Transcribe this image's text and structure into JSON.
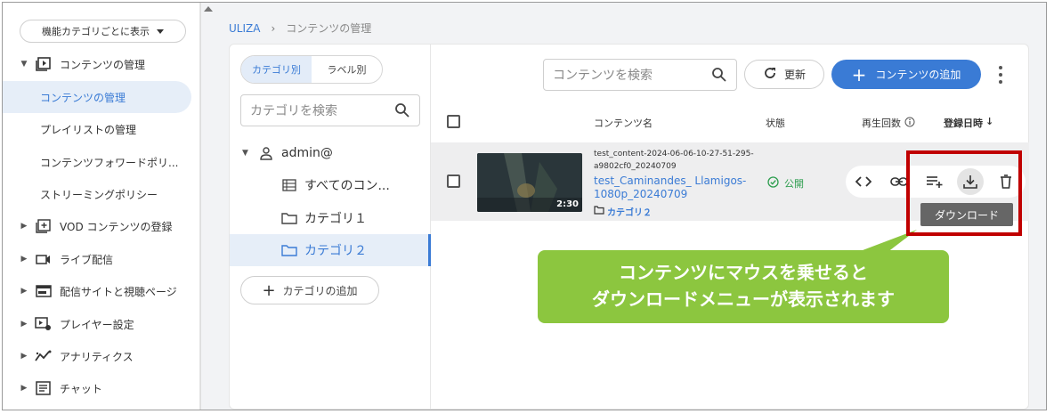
{
  "sidebar": {
    "view_select": "機能カテゴリごとに表示",
    "section_contents": "コンテンツの管理",
    "sub_items": [
      "コンテンツの管理",
      "プレイリストの管理",
      "コンテンツフォワードポリ...",
      "ストリーミングポリシー"
    ],
    "groups": [
      "VOD コンテンツの登録",
      "ライブ配信",
      "配信サイトと視聴ページ",
      "プレイヤー設定",
      "アナリティクス",
      "チャット"
    ]
  },
  "breadcrumb": {
    "root": "ULIZA",
    "sep": "›",
    "current": "コンテンツの管理"
  },
  "category_panel": {
    "toggle_category": "カテゴリ別",
    "toggle_label": "ラベル別",
    "search_placeholder": "カテゴリを検索",
    "tree": {
      "root": "admin@",
      "all": "すべてのコン...",
      "cat1": "カテゴリ１",
      "cat2": "カテゴリ２"
    },
    "add_button": "カテゴリの追加"
  },
  "toolbar": {
    "search_placeholder": "コンテンツを検索",
    "refresh": "更新",
    "add_content": "コンテンツの追加"
  },
  "table": {
    "headers": {
      "name": "コンテンツ名",
      "status": "状態",
      "plays": "再生回数",
      "registered": "登録日時"
    },
    "sort_arrow": "↓",
    "row": {
      "duration": "2:30",
      "content_id": "test_content-2024-06-06-10-27-51-295-a9802cf0_20240709",
      "title": "test_Caminandes_ Llamigos-1080p_20240709",
      "category": "カテゴリ２",
      "status": "公開"
    }
  },
  "tooltip": "ダウンロード",
  "callout": {
    "line1": "コンテンツにマウスを乗せると",
    "line2": "ダウンロードメニューが表示されます"
  },
  "colors": {
    "accent": "#3a7bd5",
    "public_green": "#2e9e4f",
    "highlight_red": "#c00000",
    "callout_green": "#8cc63f"
  }
}
